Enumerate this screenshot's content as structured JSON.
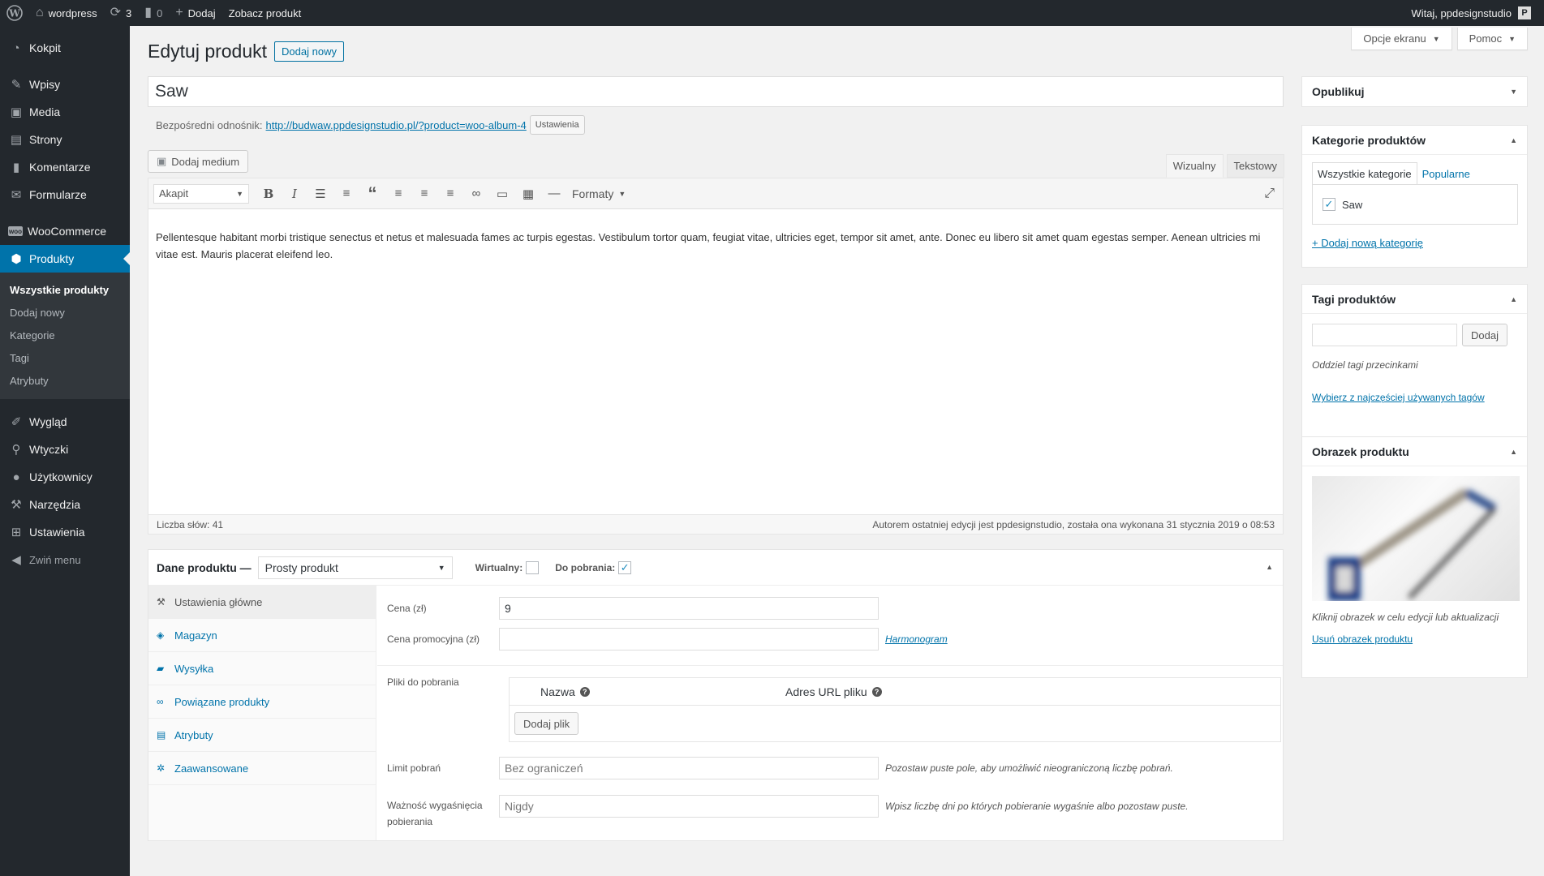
{
  "adminbar": {
    "site_name": "wordpress",
    "updates_count": "3",
    "comments_count": "0",
    "new_label": "Dodaj",
    "view_product": "Zobacz produkt",
    "greeting": "Witaj, ppdesignstudio"
  },
  "sidebar": {
    "items": [
      {
        "label": "Kokpit",
        "icon": "dashboard-icon"
      },
      {
        "label": "Wpisy",
        "icon": "pin-icon"
      },
      {
        "label": "Media",
        "icon": "media-icon"
      },
      {
        "label": "Strony",
        "icon": "page-icon"
      },
      {
        "label": "Komentarze",
        "icon": "comment-icon"
      },
      {
        "label": "Formularze",
        "icon": "mail-icon"
      },
      {
        "label": "WooCommerce",
        "icon": "woo-icon"
      },
      {
        "label": "Produkty",
        "icon": "box-icon"
      },
      {
        "label": "Wygląd",
        "icon": "brush-icon"
      },
      {
        "label": "Wtyczki",
        "icon": "plugin-icon"
      },
      {
        "label": "Użytkownicy",
        "icon": "user-icon"
      },
      {
        "label": "Narzędzia",
        "icon": "wrench-icon"
      },
      {
        "label": "Ustawienia",
        "icon": "settings-icon"
      }
    ],
    "submenu": [
      "Wszystkie produkty",
      "Dodaj nowy",
      "Kategorie",
      "Tagi",
      "Atrybuty"
    ],
    "collapse": "Zwiń menu"
  },
  "screen_meta": {
    "options": "Opcje ekranu",
    "help": "Pomoc"
  },
  "heading": {
    "title": "Edytuj produkt",
    "add_new": "Dodaj nowy"
  },
  "post": {
    "title": "Saw",
    "permalink_label": "Bezpośredni odnośnik:",
    "permalink_url": "http://budwaw.ppdesignstudio.pl/?product=woo-album-4",
    "permalink_settings": "Ustawienia"
  },
  "editor": {
    "add_media": "Dodaj medium",
    "tab_visual": "Wizualny",
    "tab_text": "Tekstowy",
    "format_select": "Akapit",
    "formats": "Formaty",
    "content": "Pellentesque habitant morbi tristique senectus et netus et malesuada fames ac turpis egestas. Vestibulum tortor quam, feugiat vitae, ultricies eget, tempor sit amet, ante. Donec eu libero sit amet quam egestas semper. Aenean ultricies mi vitae est. Mauris placerat eleifend leo.",
    "word_count": "Liczba słów: 41",
    "last_edit": "Autorem ostatniej edycji jest ppdesignstudio, została ona wykonana 31 stycznia 2019 o 08:53"
  },
  "product_data": {
    "title": "Dane produktu —",
    "type": "Prosty produkt",
    "virtual_label": "Wirtualny:",
    "downloadable_label": "Do pobrania:",
    "tabs": [
      "Ustawienia główne",
      "Magazyn",
      "Wysyłka",
      "Powiązane produkty",
      "Atrybuty",
      "Zaawansowane"
    ],
    "price_label": "Cena (zł)",
    "price_value": "9",
    "sale_label": "Cena promocyjna (zł)",
    "schedule_link": "Harmonogram",
    "files_label": "Pliki do pobrania",
    "col_name": "Nazwa",
    "col_url": "Adres URL pliku",
    "add_file": "Dodaj plik",
    "limit_label": "Limit pobrań",
    "limit_placeholder": "Bez ograniczeń",
    "limit_desc": "Pozostaw puste pole, aby umożliwić nieograniczoną liczbę pobrań.",
    "expiry_label": "Ważność wygaśnięcia pobierania",
    "expiry_placeholder": "Nigdy",
    "expiry_desc": "Wpisz liczbę dni po których pobieranie wygaśnie albo pozostaw puste."
  },
  "publish_box": {
    "title": "Opublikuj"
  },
  "categories_box": {
    "title": "Kategorie produktów",
    "tab_all": "Wszystkie kategorie",
    "tab_popular": "Popularne",
    "category": "Saw",
    "add_new": "+ Dodaj nową kategorię"
  },
  "tags_box": {
    "title": "Tagi produktów",
    "add_button": "Dodaj",
    "hint": "Oddziel tagi przecinkami",
    "choose_link": "Wybierz z najczęściej używanych tagów"
  },
  "image_box": {
    "title": "Obrazek produktu",
    "hint": "Kliknij obrazek w celu edycji lub aktualizacji",
    "remove_link": "Usuń obrazek produktu"
  }
}
